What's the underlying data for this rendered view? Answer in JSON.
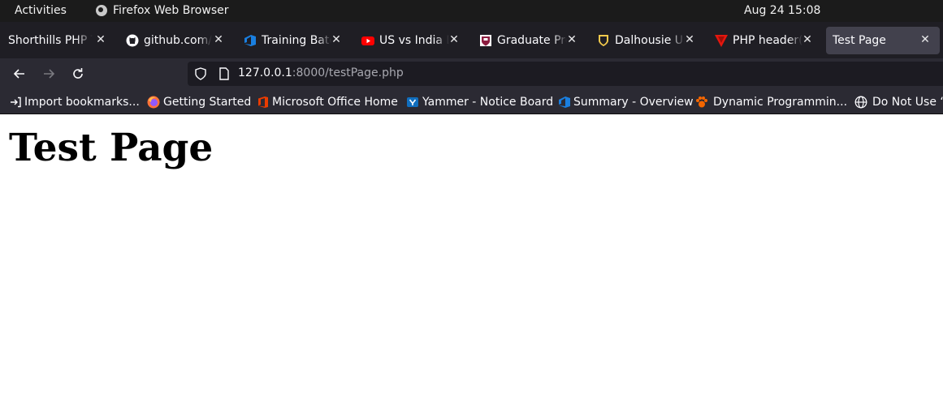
{
  "system": {
    "activities_label": "Activities",
    "app_name": "Firefox Web Browser",
    "clock": "Aug 24  15:08"
  },
  "tabs": [
    {
      "title": "Shorthills PHP Training",
      "icon": "shorthills-favicon"
    },
    {
      "title": "github.com/js",
      "icon": "github-icon"
    },
    {
      "title": "Training Batch",
      "icon": "azure-devops-icon"
    },
    {
      "title": "US vs India Debate",
      "icon": "youtube-icon"
    },
    {
      "title": "Graduate Programs",
      "icon": "university-crest-icon"
    },
    {
      "title": "Dalhousie University",
      "icon": "dalhousie-shield-icon"
    },
    {
      "title": "PHP header()",
      "icon": "red-triangle-icon"
    },
    {
      "title": "Test Page",
      "icon": "none",
      "active": true
    }
  ],
  "navbar": {
    "back_icon": "back-arrow-icon",
    "forward_icon": "forward-arrow-icon",
    "reload_icon": "reload-icon",
    "url_host": "127.0.0.1",
    "url_rest": ":8000/testPage.php"
  },
  "bookmarks": [
    {
      "label": "Import bookmarks...",
      "icon": "import-icon"
    },
    {
      "label": "Getting Started",
      "icon": "firefox-icon"
    },
    {
      "label": "Microsoft Office Home",
      "icon": "office-icon"
    },
    {
      "label": "Yammer - Notice Board",
      "icon": "yammer-icon"
    },
    {
      "label": "Summary - Overview",
      "icon": "azure-devops-icon"
    },
    {
      "label": "Dynamic Programmin...",
      "icon": "paw-icon"
    },
    {
      "label": "Do Not Use “",
      "icon": "globe-icon"
    }
  ],
  "page": {
    "heading": "Test Page"
  },
  "colors": {
    "topbar_bg": "#1b1b1b",
    "tabstrip_bg": "#1f1e24",
    "toolbar_bg": "#2b2a33",
    "urlbar_bg": "#1c1b22",
    "active_tab_bg": "#42414d"
  }
}
